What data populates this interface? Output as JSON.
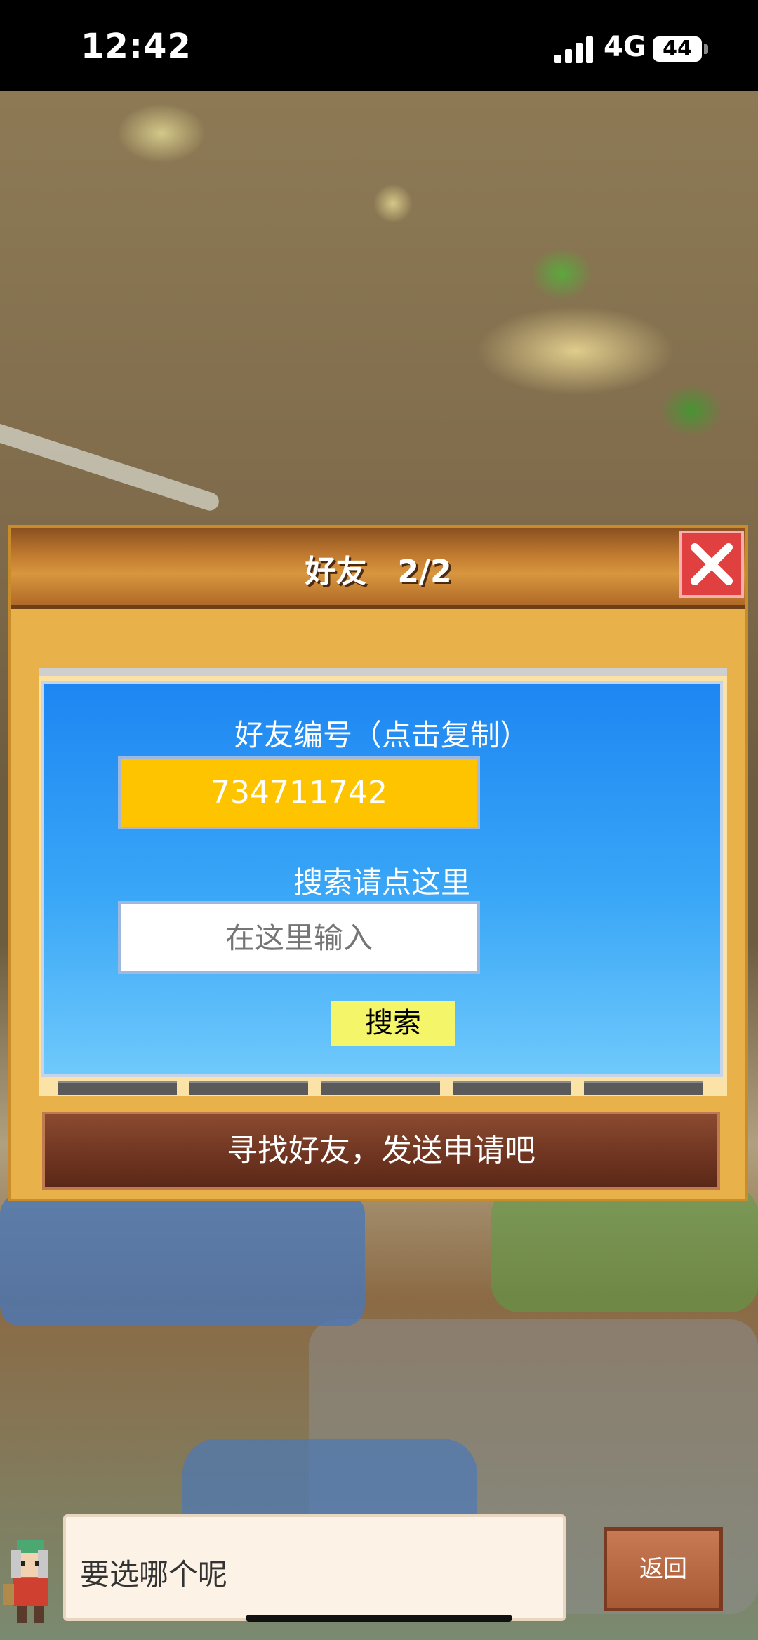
{
  "status_bar": {
    "time": "12:42",
    "network": "4G",
    "battery": "44"
  },
  "dialog": {
    "title": "好友　2/2",
    "friend_code_label": "好友编号（点击复制）",
    "friend_code": "734711742",
    "search_hint": "搜索请点这里",
    "search_placeholder": "在这里输入",
    "search_button": "搜索",
    "action_button": "寻找好友，发送申请吧"
  },
  "message": {
    "text": "要选哪个呢"
  },
  "back_button": "返回",
  "icons": [
    "close-icon",
    "arrow-left-icon",
    "arrow-right-icon",
    "signal-icon",
    "battery-icon"
  ],
  "colors": {
    "panel_blue": "#1e86f2",
    "code_yellow": "#ffc400",
    "close_red": "#e04040",
    "arrow_green": "#c8e832"
  }
}
